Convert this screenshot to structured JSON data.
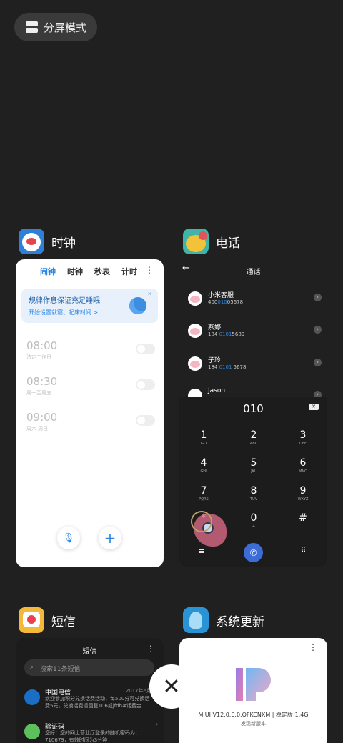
{
  "split_mode": {
    "label": "分屏模式"
  },
  "apps": {
    "clock": {
      "name": "时钟",
      "tabs": [
        "闹钟",
        "时钟",
        "秒表",
        "计时"
      ],
      "banner": {
        "title": "规律作息保证充足睡眠",
        "subtitle": "开始设置就寝、起床时间 >"
      },
      "alarms": [
        {
          "time": "08:00",
          "label": "法定工作日",
          "enabled": false
        },
        {
          "time": "08:30",
          "label": "周一至周五",
          "enabled": false
        },
        {
          "time": "09:00",
          "label": "周六 周日",
          "enabled": false
        }
      ]
    },
    "phone": {
      "name": "电话",
      "header": "通话",
      "contacts": [
        {
          "name": "小米客服",
          "number_pre": "400",
          "number_hl": "010",
          "number_post": "05678"
        },
        {
          "name": "燕婷",
          "number_pre": "184 ",
          "number_hl": "0101",
          "number_post": "5689"
        },
        {
          "name": "子玲",
          "number_pre": "184 ",
          "number_hl": "0101",
          "number_post": " 5678"
        },
        {
          "name": "Jason",
          "number_pre": "",
          "number_hl": "",
          "number_post": ""
        }
      ],
      "dial_display": "010",
      "keys": [
        {
          "d": "1",
          "l": "GO"
        },
        {
          "d": "2",
          "l": "ABC"
        },
        {
          "d": "3",
          "l": "DEF"
        },
        {
          "d": "4",
          "l": "GHI"
        },
        {
          "d": "5",
          "l": "JKL"
        },
        {
          "d": "6",
          "l": "MNO"
        },
        {
          "d": "7",
          "l": "PQRS"
        },
        {
          "d": "8",
          "l": "TUV"
        },
        {
          "d": "9",
          "l": "WXYZ"
        },
        {
          "d": "*",
          "l": ""
        },
        {
          "d": "0",
          "l": "+"
        },
        {
          "d": "#",
          "l": ""
        }
      ]
    },
    "sms": {
      "name": "短信",
      "header": "短信",
      "search_placeholder": "搜索11条短信",
      "threads": [
        {
          "name": "中国电信",
          "time": "2017年6月30",
          "preview": "欢迎参加积分兑换话费活动，每500分可兑换话费5元，兑换话费请回复106或jfdh#话费金..."
        },
        {
          "name": "验证码",
          "time": "",
          "preview": "您好！您的网上营业厅登录的随机密码为：710679，有效时间为3分钟"
        }
      ]
    },
    "update": {
      "name": "系统更新",
      "version": "MIUI V12.0.6.0.QFKCNXM | 稳定版 1.4G",
      "subtitle": "发现新版本"
    }
  },
  "colors": {
    "accent": "#2b87e3",
    "background": "#202020"
  }
}
